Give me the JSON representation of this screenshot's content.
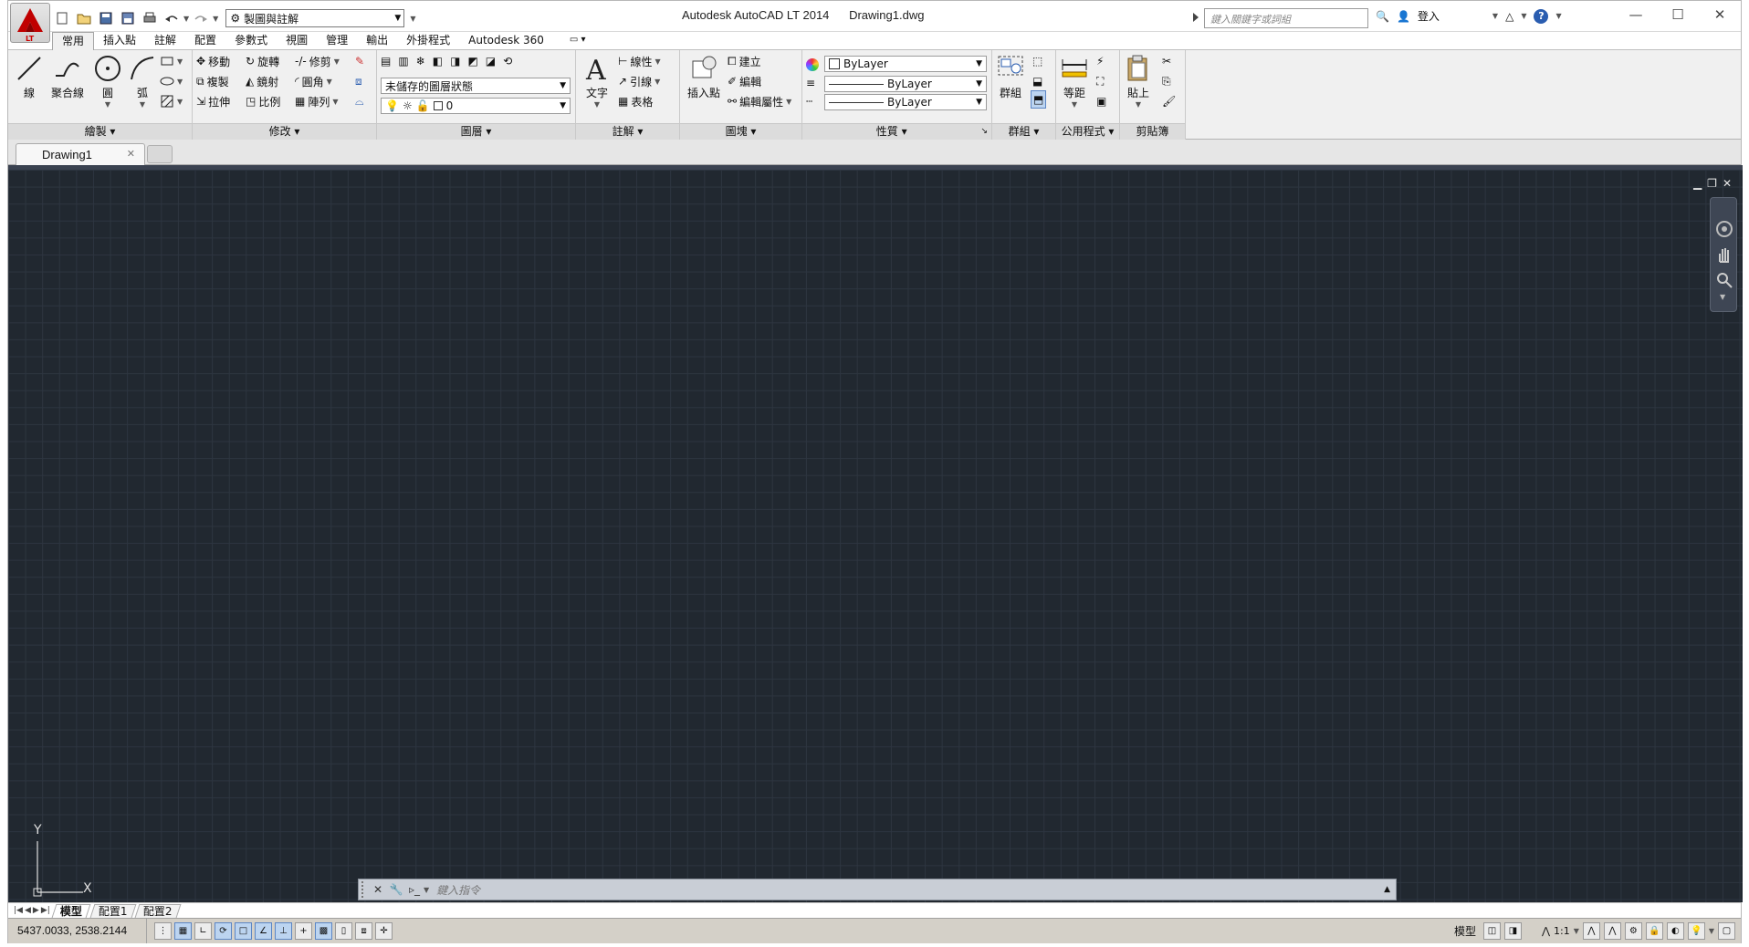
{
  "window": {
    "title": "Autodesk AutoCAD LT 2014",
    "filename": "Drawing1.dwg",
    "logo_badge": "LT",
    "workspace": "製圖與註解",
    "search_placeholder": "鍵入關鍵字或詞組",
    "signin_label": "登入"
  },
  "ribbon_tabs": [
    "常用",
    "插入點",
    "註解",
    "配置",
    "參數式",
    "視圖",
    "管理",
    "輸出",
    "外掛程式",
    "Autodesk 360"
  ],
  "panels": {
    "draw": {
      "title": "繪製",
      "line": "線",
      "polyline": "聚合線",
      "circle": "圓",
      "arc": "弧"
    },
    "modify": {
      "title": "修改",
      "move": "移動",
      "rotate": "旋轉",
      "trim": "修剪",
      "copy": "複製",
      "mirror": "鏡射",
      "fillet": "圓角",
      "stretch": "拉伸",
      "scale": "比例",
      "array": "陣列"
    },
    "layers": {
      "title": "圖層",
      "state": "未儲存的圖層狀態",
      "current": "0"
    },
    "annotation": {
      "title": "註解",
      "text": "文字",
      "linear": "線性",
      "leader": "引線",
      "table": "表格"
    },
    "block": {
      "title": "圖塊",
      "insert": "插入點",
      "create": "建立",
      "edit": "編輯",
      "edit_attr": "編輯屬性"
    },
    "properties": {
      "title": "性質",
      "color": "ByLayer",
      "lineweight": "ByLayer",
      "linetype": "ByLayer"
    },
    "groups": {
      "title": "群組",
      "group": "群組"
    },
    "utilities": {
      "title": "公用程式",
      "measure": "等距"
    },
    "clipboard": {
      "title": "剪貼簿",
      "paste": "貼上"
    }
  },
  "document": {
    "tab": "Drawing1"
  },
  "ucs": {
    "x": "X",
    "y": "Y"
  },
  "command": {
    "placeholder": "鍵入指令"
  },
  "layout_tabs": [
    "模型",
    "配置1",
    "配置2"
  ],
  "status": {
    "coordinates": "5437.0033, 2538.2144",
    "model": "模型",
    "scale": "1:1"
  },
  "colors": {
    "canvas": "#212830",
    "grid": "#2d3540",
    "ribbon": "#f0f0f0",
    "accent": "#c00000"
  }
}
